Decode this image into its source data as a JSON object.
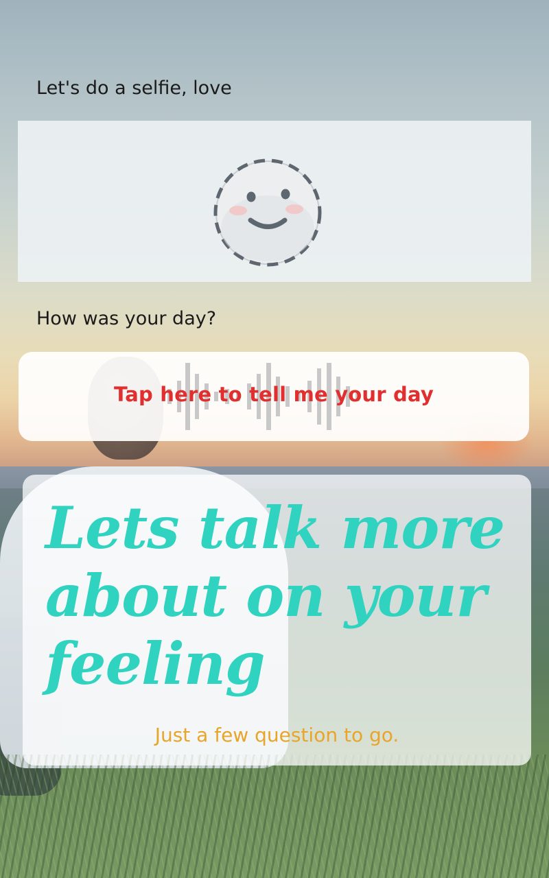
{
  "selfie": {
    "label": "Let's do a selfie, love",
    "icon": "smiley-face-icon"
  },
  "day": {
    "label": "How was your day?",
    "prompt": "Tap here to tell me your day",
    "icon": "sound-wave-icon"
  },
  "feeling": {
    "title": "Lets talk more about on your feeling",
    "subtitle": "Just a few question to go."
  },
  "colors": {
    "prompt_red": "#e12e2e",
    "title_teal": "#2fd3c0",
    "subtitle_orange": "#e8a52a"
  }
}
